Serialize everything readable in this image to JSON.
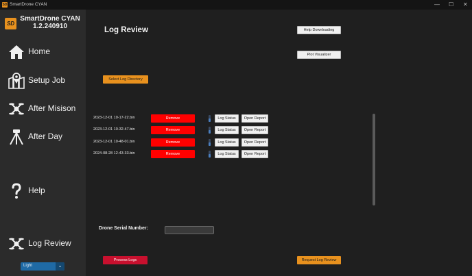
{
  "window": {
    "title": "SmartDrone CYAN",
    "icon_text": "SD",
    "minimize": "—",
    "maximize": "☐",
    "close": "✕"
  },
  "sidebar": {
    "logo_text": "SD",
    "brand_name": "SmartDrone CYAN",
    "version": "1.2.240910",
    "nav": {
      "home": "Home",
      "setup_job": "Setup Job",
      "after_mission": "After Misison",
      "after_day": "After Day",
      "help": "Help",
      "log_review": "Log Review"
    },
    "theme": {
      "value": "Light",
      "arrow": "⌄"
    }
  },
  "main": {
    "title": "Log Review",
    "help_downloading": "Help Downloading",
    "plot_visualizer": "Plot Visualizer",
    "select_log_directory": "Select Log Directory",
    "logs": [
      {
        "file": "2023-12-01 10-17-22.bin",
        "remove": "Remove",
        "status": "Log Status",
        "report": "Open Report"
      },
      {
        "file": "2023-12-01 10-32-47.bin",
        "remove": "Remove",
        "status": "Log Status",
        "report": "Open Report"
      },
      {
        "file": "2023-12-01 10-48-01.bin",
        "remove": "Remove",
        "status": "Log Status",
        "report": "Open Report"
      },
      {
        "file": "2024-08-28 12-43-33.bin",
        "remove": "Remove",
        "status": "Log Status",
        "report": "Open Report"
      }
    ],
    "serial_label": "Drone Serial Number:",
    "serial_value": "",
    "process_logs": "Process Logs",
    "request_log_review": "Request Log Review"
  }
}
